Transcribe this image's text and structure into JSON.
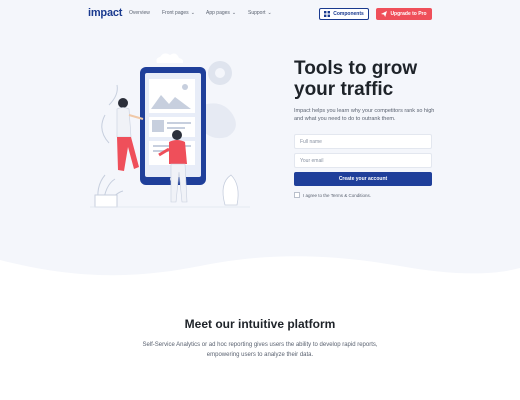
{
  "nav": {
    "logo": "impact",
    "items": [
      {
        "label": "Overview",
        "has_menu": false
      },
      {
        "label": "Front pages",
        "has_menu": true
      },
      {
        "label": "App pages",
        "has_menu": true
      },
      {
        "label": "Support",
        "has_menu": true
      }
    ],
    "components_label": "Components",
    "pro_label": "Upgrade to Pro"
  },
  "hero": {
    "title": "Tools to grow your traffic",
    "description": "Impact helps you learn why your competitors rank so high and what you need to do to outrank them.",
    "form": {
      "full_name_placeholder": "Full name",
      "email_placeholder": "Your email",
      "submit_label": "Create your account",
      "agree_text": "I agree to the Terms & Conditions."
    }
  },
  "features": {
    "title": "Meet our intuitive platform",
    "description": "Self-Service Analytics or ad hoc reporting gives users the ability to develop rapid reports, empowering users to analyze their data."
  },
  "colors": {
    "brand": "#1a3a8f",
    "accent": "#ef4f5a",
    "hero_bg": "#f4f6fb",
    "button": "#1f3f9a"
  },
  "icons": [
    "grid-icon",
    "send-icon",
    "chevron-down-icon",
    "phone-illustration",
    "gear-icon"
  ]
}
